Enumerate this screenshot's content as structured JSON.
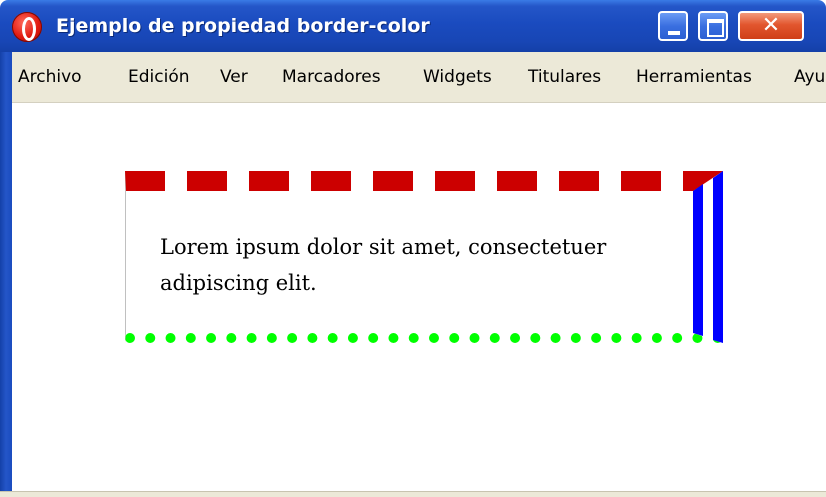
{
  "window": {
    "title": "Ejemplo de propiedad border-color",
    "app_icon": "opera-logo-icon",
    "controls": {
      "minimize_icon": "minimize-icon",
      "maximize_icon": "maximize-icon",
      "close_icon": "close-icon",
      "close_glyph": "✕"
    }
  },
  "menubar": {
    "items": [
      {
        "label": "Archivo"
      },
      {
        "label": "Edición"
      },
      {
        "label": "Ver"
      },
      {
        "label": "Marcadores"
      },
      {
        "label": "Widgets"
      },
      {
        "label": "Titulares"
      },
      {
        "label": "Herramientas"
      },
      {
        "label": "Ayu"
      }
    ]
  },
  "content": {
    "paragraph": "Lorem ipsum dolor sit amet, consectetuer adipiscing elit.",
    "border_colors": {
      "top": "#cc0000",
      "right": "#0000ff",
      "bottom": "#00ff00",
      "left": "#c0c0c0"
    },
    "border_styles": {
      "top": "dashed",
      "right": "double",
      "bottom": "dotted",
      "left": "solid"
    }
  },
  "colors": {
    "titlebar": "#1a4bbf",
    "menubar": "#ece9d8",
    "close_button": "#e2562e"
  }
}
